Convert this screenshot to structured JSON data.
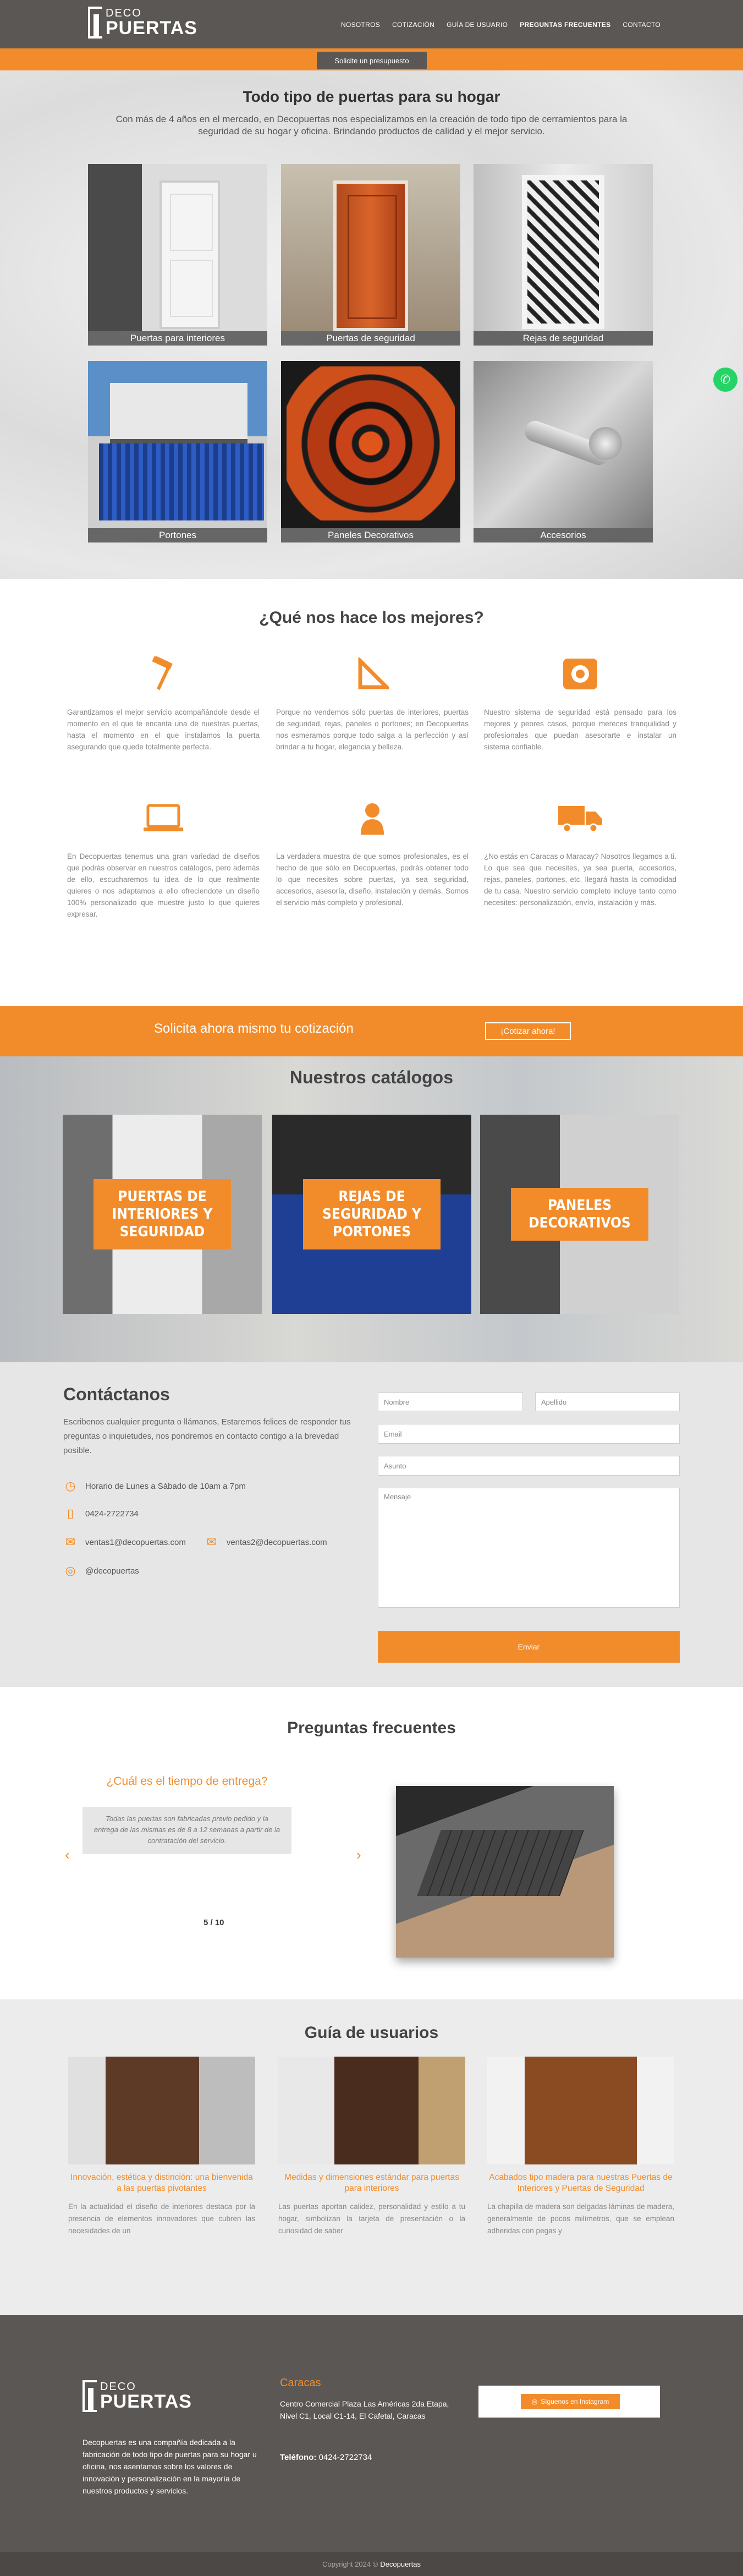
{
  "brand": {
    "deco": "DECO",
    "puertas": "PUERTAS"
  },
  "nav": [
    {
      "label": "NOSOTROS",
      "active": false
    },
    {
      "label": "COTIZACIÓN",
      "active": false
    },
    {
      "label": "GUÍA DE USUARIO",
      "active": false
    },
    {
      "label": "PREGUNTAS FRECUENTES",
      "active": true
    },
    {
      "label": "CONTACTO",
      "active": false
    }
  ],
  "budget_button": "Solicite un presupuesto",
  "products": {
    "title": "Todo tipo de puertas para su hogar",
    "subtitle": "Con más de 4 años en el mercado, en Decopuertas nos especializamos en la creación de todo tipo de cerramientos para la seguridad de su hogar y oficina. Brindando productos de calidad y el mejor servicio.",
    "items": [
      "Puertas para interiores",
      "Puertas de seguridad",
      "Rejas de seguridad",
      "Portones",
      "Paneles Decorativos",
      "Accesorios"
    ]
  },
  "why": {
    "title": "¿Qué nos hace los mejores?",
    "features": [
      {
        "icon": "hammer-icon",
        "text": "Garantizamos el mejor servicio acompañándole desde el momento en el que te encanta una de nuestras puertas, hasta el momento en el que instalamos la puerta asegurando que quede totalmente perfecta."
      },
      {
        "icon": "set-square-icon",
        "text": "Porque no vendemos sólo puertas de interiores, puertas de seguridad, rejas, paneles o portones; en Decopuertas nos esmeramos porque todo salga a la perfección y así brindar a tu hogar, elegancia y belleza."
      },
      {
        "icon": "safe-icon",
        "text": "Nuestro sistema de seguridad está pensado para los mejores y peores casos, porque mereces tranquilidad y profesionales que puedan asesorarte e instalar un sistema confiable."
      },
      {
        "icon": "laptop-icon",
        "text": "En Decopuertas tenemus una gran variedad de diseños que podrás observar en nuestros catálogos, pero además de ello, escucharemos tu idea de lo que realmente quieres o nos adaptamos a ello ofreciendote un diseño 100% personalizado que muestre justo lo que quieres expresar."
      },
      {
        "icon": "user-icon",
        "text": "La verdadera muestra de que somos profesionales, es el hecho de que sólo en Decopuertas, podrás obtener todo lo que necesites sobre puertas, ya sea seguridad, accesorios, asesoría, diseño, instalación y demás. Somos el servicio más completo y profesional."
      },
      {
        "icon": "truck-icon",
        "text": "¿No estás en Caracas o Maracay? Nosotros llegamos a ti. Lo que sea que necesites, ya sea puerta, accesorios, rejas, paneles, portones, etc, llegará hasta la comodidad de tu casa. Nuestro servicio completo incluye tanto como necesites: personalización, envío, instalación y más."
      }
    ]
  },
  "cta": {
    "text": "Solicita ahora mismo tu cotización",
    "button": "¡Cotizar ahora!"
  },
  "catalogs": {
    "title": "Nuestros catálogos",
    "items": [
      "PUERTAS DE INTERIORES Y SEGURIDAD",
      "REJAS DE SEGURIDAD Y PORTONES",
      "PANELES DECORATIVOS"
    ]
  },
  "contact": {
    "title": "Contáctanos",
    "intro": "Escribenos cualquier pregunta o llámanos, Estaremos felices de responder tus preguntas o inquietudes, nos pondremos en contacto contigo a la brevedad posible.",
    "hours": "Horario de Lunes a Sábado de 10am a 7pm",
    "phone": "0424-2722734",
    "email1": "ventas1@decopuertas.com",
    "email2": "ventas2@decopuertas.com",
    "instagram": "@decopuertas",
    "form": {
      "name": "Nombre",
      "lastname": "Apellido",
      "email": "Email",
      "subject": "Asunto",
      "message": "Mensaje",
      "send": "Enviar"
    }
  },
  "faq": {
    "title": "Preguntas frecuentes",
    "question": "¿Cuál es el tiempo de entrega?",
    "answer": "Todas las puertas son fabricadas previo pedido y la entrega de las mismas es de 8 a 12 semanas a partir de la contratación del servicio.",
    "counter": "5 / 10",
    "prev": "‹",
    "next": "›"
  },
  "guide": {
    "title": "Guía de usuarios",
    "cards": [
      {
        "title": "Innovación, estética y distinción: una bienvenida a las puertas pivotantes",
        "text": "En la actualidad el diseño de interiores destaca por la presencia de elementos innovadores que cubren las necesidades de un"
      },
      {
        "title": "Medidas y dimensiones estándar para puertas para interiores",
        "text": "Las puertas aportan calidez, personalidad y estilo a tu hogar, simbolizan la tarjeta de presentación o la curiosidad de saber"
      },
      {
        "title": "Acabados tipo madera para nuestras Puertas de Interiores y Puertas de Seguridad",
        "text": "La chapilla de madera son delgadas láminas de madera, generalmente de pocos milímetros, que se emplean adheridas con pegas y"
      }
    ]
  },
  "footer": {
    "about": "Decopuertas es una compañía dedicada a la fabricación de todo tipo de puertas para su hogar u oficina, nos asentamos sobre los valores de innovación y personalización en la mayoría de nuestros productos y servicios.",
    "city": "Caracas",
    "address": "Centro Comercial Plaza Las Américas 2da Etapa, Nivel C1, Local C1-14, El Cafetal, Caracas",
    "phone_label": "Teléfono:",
    "phone": "0424-2722734",
    "instagram_button": "Síguenos en Instagram",
    "copyright": "Copyright 2024 ©",
    "copyright_brand": "Decopuertas"
  },
  "colors": {
    "accent": "#f28c2b",
    "dark": "#5b5754",
    "whatsapp": "#25d366"
  }
}
